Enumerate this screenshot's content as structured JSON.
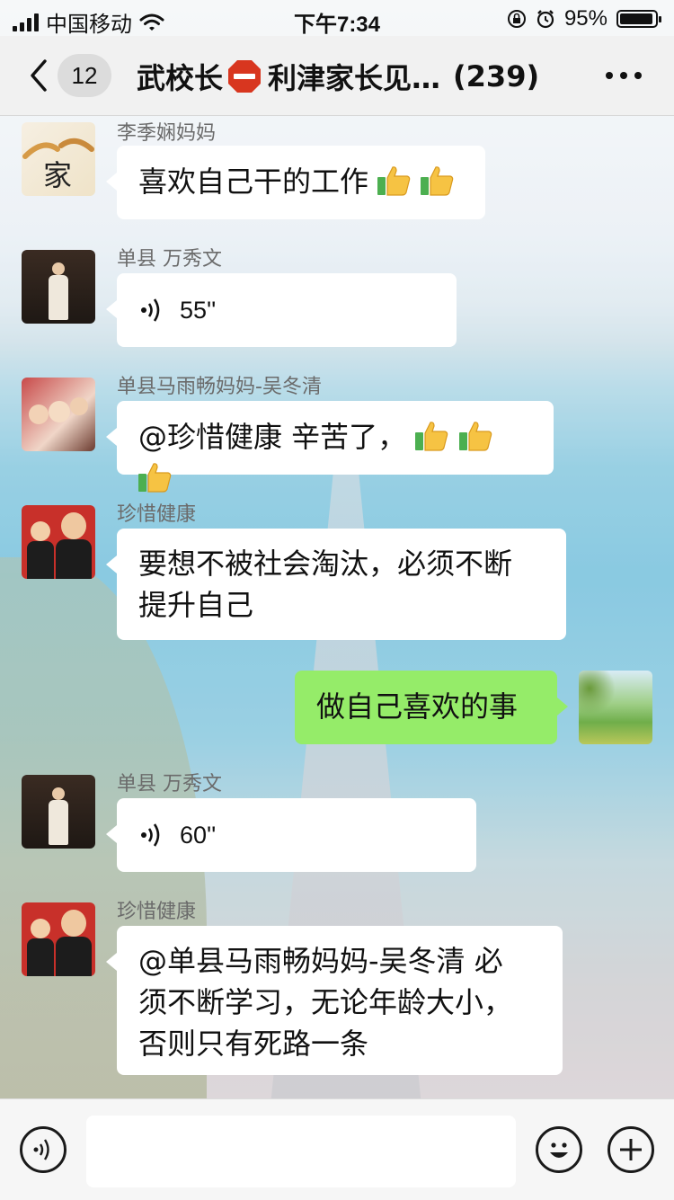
{
  "status_bar": {
    "carrier": "中国移动",
    "time": "下午7:34",
    "battery": "95%"
  },
  "nav": {
    "unread_count": "12",
    "title_prefix": "武校长",
    "title_suffix": "利津家长见…",
    "member_count": "(239)"
  },
  "messages": [
    {
      "sender": "李季娴妈妈",
      "text": "喜欢自己干的工作"
    },
    {
      "sender": "单县  万秀文",
      "duration": "55''"
    },
    {
      "sender": "单县马雨畅妈妈-吴冬清",
      "text": "@珍惜健康 辛苦了，"
    },
    {
      "sender": "珍惜健康",
      "line1": "要想不被社会淘汰，必须不断",
      "line2": "提升自己"
    },
    {
      "text": "做自己喜欢的事"
    },
    {
      "sender": "单县  万秀文",
      "duration": "60''"
    },
    {
      "sender": "珍惜健康",
      "line1": "@单县马雨畅妈妈-吴冬清  必",
      "line2": "须不断学习，无论年龄大小，",
      "line3": "否则只有死路一条"
    }
  ],
  "avatar_text": "家",
  "colors": {
    "my_bubble": "#95ec69",
    "other_bubble": "#ffffff",
    "stop_sign": "#d8361f"
  }
}
